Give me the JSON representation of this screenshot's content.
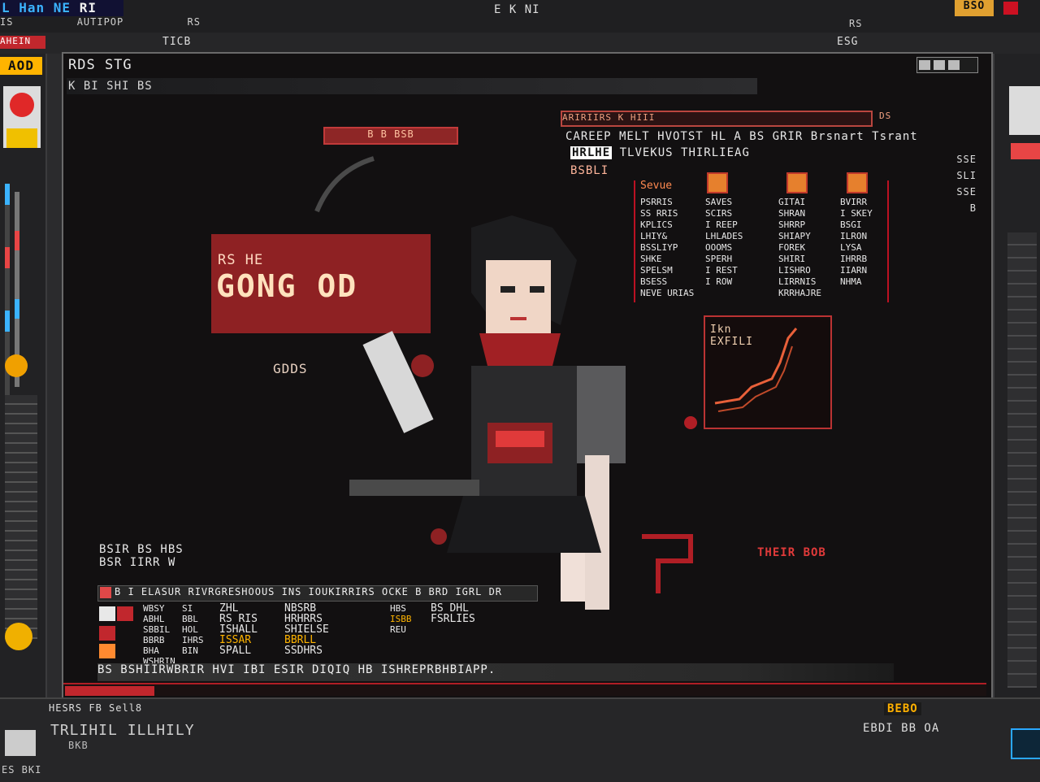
{
  "app": {
    "logo": "L Han NE",
    "logo_suffix": "RI",
    "title": "E K NI",
    "top_right_badge": "BSO",
    "menu_left": [
      "IS",
      "AUTIPOP",
      "RS"
    ],
    "menu_right": "RS",
    "toolbar_left": "AHEIN",
    "toolbar_center": "TICB",
    "toolbar_right": "ESG"
  },
  "canvas": {
    "title": "RDS STG",
    "subtitle": "K BI  SHI BS"
  },
  "hud": {
    "score": "AOD",
    "tag": "B  B  BSB",
    "banner_small": "RS     HE",
    "banner_title": "GONG OD",
    "banner_foot": "GDDS",
    "red_status": "THEIR BOB"
  },
  "info": {
    "header": "ARIRIIRS    K  HIII",
    "header2": "DS",
    "line1": "CAREEP MELT HVOTST HL A  BS  GRIR  Brsnart Tsrant",
    "line2_hl": "HRLHE",
    "line2": "TLVEKUS THIRLIEAG",
    "line3": "BSBLI",
    "right_labels": [
      "SSE",
      "SLI",
      "SSE",
      "B"
    ]
  },
  "stats": {
    "columns": [
      {
        "header": "Sevue",
        "rows": [
          "PSRRIS",
          "SS RRIS",
          "KPLICS",
          "LHIY&",
          "BSSLIYP",
          "SHKE",
          "SPELSM",
          "BSESS",
          "NEVE URIAS"
        ]
      },
      {
        "header": "",
        "rows": [
          "SAVES",
          "SCIRS",
          "I REEP",
          "LHLADES",
          "OOOMS",
          "SPERH",
          "I REST",
          "I ROW"
        ]
      },
      {
        "header": "",
        "rows": [
          "GITAI",
          "SHRAN",
          "SHRRP",
          "SHIAPY",
          "FOREK",
          "SHIRI",
          "LISHRO",
          "LIRRNIS",
          "KRRHAJRE"
        ]
      },
      {
        "header": "",
        "rows": [
          "BVIRR",
          "I SKEY",
          "BSGI",
          "ILRON",
          "LYSA",
          "IHRRB",
          "IIARN",
          "NHMA"
        ]
      }
    ]
  },
  "graph": {
    "title_top": "Ikn",
    "title": "EXFILI"
  },
  "bottom_left": {
    "title_line1": "BSIR  BS  HBS",
    "title_line2": "BSR IIRR W",
    "bar_text": "B  I ELASUR RIVRGRESHOOUS INS  IOUKIRRIRS OCKE  B  BRD  IGRL DR",
    "rows": [
      [
        "WBSY",
        "SI",
        "ZHL",
        "NBSRB",
        "HBS",
        "BS  DHL"
      ],
      [
        "ABHL",
        "BBL",
        "RS RIS",
        "HRHRRS",
        "ISBB",
        "FSRLIES"
      ],
      [
        "SBBIL",
        "HOL",
        "ISHALL",
        "SHIELSE",
        "REU",
        ""
      ],
      [
        "BBRB",
        "IHRS",
        "ISSAR",
        "BBRLL",
        "",
        ""
      ],
      [
        "BHA",
        "BIN",
        "SPALL",
        "SSDHRS",
        "",
        ""
      ],
      [
        "WSHRIN",
        "",
        "",
        "",
        "",
        ""
      ]
    ],
    "footer": "BS BSHIIRWBRIR  HVI  IBI  ESIR DIQIQ  HB  ISHREPRBHBIAPP."
  },
  "status": {
    "left1": "HESRS  FB Sell8",
    "left2": "TRLIHIL  ILLHILY",
    "left3": "BKB",
    "foot": "ES BKI",
    "right1": "BEBO",
    "right2": "EBDI  BB  OA"
  },
  "colors": {
    "accent": "#c1272d",
    "background": "#2b2b2d",
    "canvas": "#121011",
    "gold": "#ffb400",
    "highlight": "#ff8a50"
  }
}
